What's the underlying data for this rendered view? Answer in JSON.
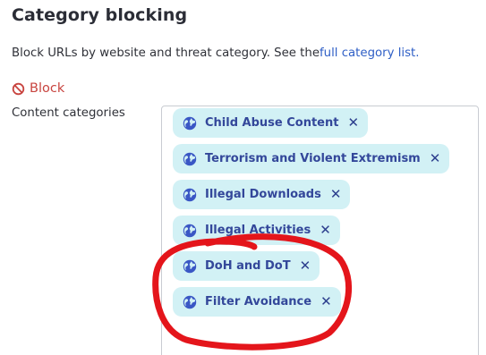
{
  "section": {
    "title": "Category blocking",
    "description": "Block URLs by website and threat category. See the",
    "link_text": "full category list."
  },
  "block": {
    "label": "Block",
    "color": "#c8443f"
  },
  "content_categories": {
    "label": "Content categories",
    "chips": [
      {
        "label": "Child Abuse Content"
      },
      {
        "label": "Terrorism and Violent Extremism"
      },
      {
        "label": "Illegal Downloads"
      },
      {
        "label": "Illegal Activities"
      },
      {
        "label": "DoH and DoT"
      },
      {
        "label": "Filter Avoidance"
      }
    ],
    "remove_symbol": "✕"
  },
  "colors": {
    "chip_background": "#d2f1f5",
    "chip_text": "#33479a",
    "link": "#2f5fc6",
    "annotation_stroke": "#e4151b"
  }
}
